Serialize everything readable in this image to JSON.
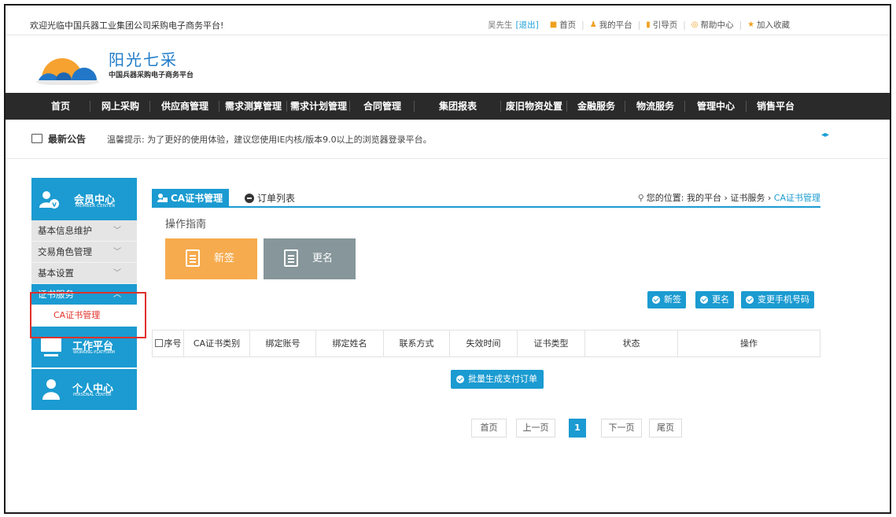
{
  "topbar": {
    "welcome": "欢迎光临中国兵器工业集团公司采购电子商务平台!",
    "user": "吴先生",
    "logout": "[退出]",
    "links": [
      "首页",
      "我的平台",
      "引导页",
      "帮助中心",
      "加入收藏"
    ]
  },
  "logo": {
    "title": "阳光七采",
    "subtitle": "中国兵器采购电子商务平台"
  },
  "nav": {
    "items": [
      "首页",
      "网上采购",
      "供应商管理",
      "需求测算管理",
      "需求计划管理",
      "合同管理",
      "集团报表",
      "废旧物资处置",
      "金融服务",
      "物流服务",
      "管理中心",
      "销售平台"
    ]
  },
  "notice": {
    "title": "最新公告",
    "text": "温馨提示: 为了更好的使用体验，建议您使用IE内核/版本9.0以上的浏览器登录平台。"
  },
  "sidebar": {
    "member": {
      "title": "会员中心",
      "sub": "MEMBER CENTER"
    },
    "items": [
      "基本信息维护",
      "交易角色管理",
      "基本设置",
      "证书服务"
    ],
    "sub_item": "CA证书管理",
    "work": {
      "title": "工作平台",
      "sub": "WORKING PLATFORM"
    },
    "personal": {
      "title": "个人中心",
      "sub": "PERSONAL CENTER"
    }
  },
  "main": {
    "tab_active": "CA证书管理",
    "tab_other": "订单列表",
    "crumb_prefix": "您的位置: 我的平台 › 证书服务 › ",
    "crumb_current": "CA证书管理",
    "guide": "操作指南",
    "btn_new": "新签",
    "btn_rename": "更名",
    "small_buttons": [
      "新签",
      "更名",
      "变更手机号码"
    ],
    "columns": [
      "序号",
      "CA证书类别",
      "绑定账号",
      "绑定姓名",
      "联系方式",
      "失效时间",
      "证书类型",
      "状态",
      "操作"
    ],
    "batch": "批量生成支付订单"
  },
  "pagination": {
    "first": "首页",
    "prev": "上一页",
    "current": "1",
    "next": "下一页",
    "last": "尾页"
  },
  "colors": {
    "accent": "#1b9bd1",
    "nav_bg": "#2a2a2a",
    "orange": "#f6ab4e",
    "gray_btn": "#86969a",
    "highlight": "#e0302a"
  }
}
